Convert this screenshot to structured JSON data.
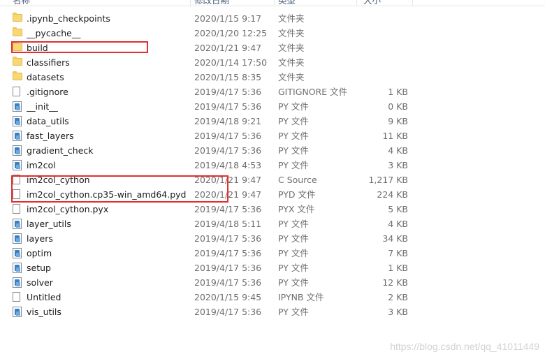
{
  "header": {
    "name_label": "名称",
    "date_label": "修改日期",
    "type_label": "类型",
    "size_label": "大小"
  },
  "files": [
    {
      "name": ".ipynb_checkpoints",
      "date": "2020/1/15 9:17",
      "type": "文件夹",
      "size": "",
      "icon": "folder-icon"
    },
    {
      "name": "__pycache__",
      "date": "2020/1/20 12:25",
      "type": "文件夹",
      "size": "",
      "icon": "folder-icon"
    },
    {
      "name": "build",
      "date": "2020/1/21 9:47",
      "type": "文件夹",
      "size": "",
      "icon": "folder-icon"
    },
    {
      "name": "classifiers",
      "date": "2020/1/14 17:50",
      "type": "文件夹",
      "size": "",
      "icon": "folder-icon"
    },
    {
      "name": "datasets",
      "date": "2020/1/15 8:35",
      "type": "文件夹",
      "size": "",
      "icon": "folder-icon"
    },
    {
      "name": ".gitignore",
      "date": "2019/4/17 5:36",
      "type": "GITIGNORE 文件",
      "size": "1 KB",
      "icon": "file-icon"
    },
    {
      "name": "__init__",
      "date": "2019/4/17 5:36",
      "type": "PY 文件",
      "size": "0 KB",
      "icon": "python-file-icon"
    },
    {
      "name": "data_utils",
      "date": "2019/4/18 9:21",
      "type": "PY 文件",
      "size": "9 KB",
      "icon": "python-file-icon"
    },
    {
      "name": "fast_layers",
      "date": "2019/4/17 5:36",
      "type": "PY 文件",
      "size": "11 KB",
      "icon": "python-file-icon"
    },
    {
      "name": "gradient_check",
      "date": "2019/4/17 5:36",
      "type": "PY 文件",
      "size": "4 KB",
      "icon": "python-file-icon"
    },
    {
      "name": "im2col",
      "date": "2019/4/18 4:53",
      "type": "PY 文件",
      "size": "3 KB",
      "icon": "python-file-icon"
    },
    {
      "name": "im2col_cython",
      "date": "2020/1/21 9:47",
      "type": "C Source",
      "size": "1,217 KB",
      "icon": "c-source-icon"
    },
    {
      "name": "im2col_cython.cp35-win_amd64.pyd",
      "date": "2020/1/21 9:47",
      "type": "PYD 文件",
      "size": "224 KB",
      "icon": "file-icon"
    },
    {
      "name": "im2col_cython.pyx",
      "date": "2019/4/17 5:36",
      "type": "PYX 文件",
      "size": "5 KB",
      "icon": "file-icon"
    },
    {
      "name": "layer_utils",
      "date": "2019/4/18 5:11",
      "type": "PY 文件",
      "size": "4 KB",
      "icon": "python-file-icon"
    },
    {
      "name": "layers",
      "date": "2019/4/17 5:36",
      "type": "PY 文件",
      "size": "34 KB",
      "icon": "python-file-icon"
    },
    {
      "name": "optim",
      "date": "2019/4/17 5:36",
      "type": "PY 文件",
      "size": "7 KB",
      "icon": "python-file-icon"
    },
    {
      "name": "setup",
      "date": "2019/4/17 5:36",
      "type": "PY 文件",
      "size": "1 KB",
      "icon": "python-file-icon"
    },
    {
      "name": "solver",
      "date": "2019/4/17 5:36",
      "type": "PY 文件",
      "size": "12 KB",
      "icon": "python-file-icon"
    },
    {
      "name": "Untitled",
      "date": "2020/1/15 9:45",
      "type": "IPYNB 文件",
      "size": "2 KB",
      "icon": "file-icon"
    },
    {
      "name": "vis_utils",
      "date": "2019/4/17 5:36",
      "type": "PY 文件",
      "size": "3 KB",
      "icon": "python-file-icon"
    }
  ],
  "watermark": "https://blog.csdn.net/qq_41011449",
  "colors": {
    "highlight": "#e03030",
    "folder": "#f8d775",
    "secondary_text": "#6d6d6d"
  }
}
